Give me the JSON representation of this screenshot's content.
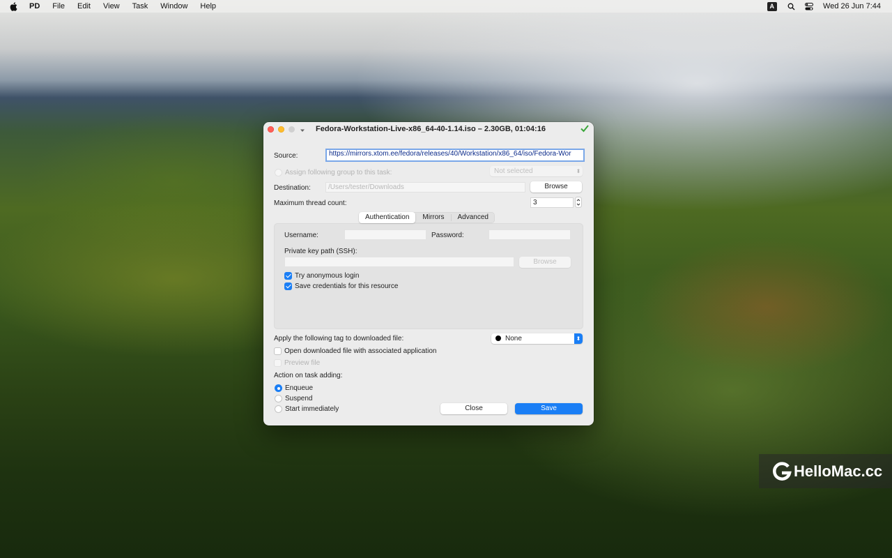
{
  "menubar": {
    "app_name": "PD",
    "menus": [
      "File",
      "Edit",
      "View",
      "Task",
      "Window",
      "Help"
    ],
    "input_badge": "A",
    "datetime": "Wed 26 Jun  7:44"
  },
  "dialog": {
    "title": "Fedora-Workstation-Live-x86_64-40-1.14.iso – 2.30GB, 01:04:16",
    "source_label": "Source:",
    "source_value": "https://mirrors.xtom.ee/fedora/releases/40/Workstation/x86_64/iso/Fedora-Wor",
    "assign_group_label": "Assign following group to this task:",
    "group_select_value": "Not selected",
    "destination_label": "Destination:",
    "destination_value": "/Users/tester/Downloads",
    "browse_label": "Browse",
    "max_thread_label": "Maximum thread count:",
    "max_thread_value": "3",
    "tabs": [
      "Authentication",
      "Mirrors",
      "Advanced"
    ],
    "active_tab": "Authentication",
    "auth": {
      "username_label": "Username:",
      "username_value": "",
      "password_label": "Password:",
      "password_value": "",
      "key_path_label": "Private key path (SSH):",
      "key_path_value": "",
      "browse_label": "Browse",
      "try_anonymous_label": "Try anonymous login",
      "try_anonymous_checked": true,
      "save_credentials_label": "Save credentials for this resource",
      "save_credentials_checked": true
    },
    "tag_label": "Apply the following tag to downloaded file:",
    "tag_value": "None",
    "open_file_label": "Open downloaded file with associated application",
    "open_file_checked": false,
    "preview_label": "Preview file",
    "action_label": "Action on task adding:",
    "actions": [
      "Enqueue",
      "Suspend",
      "Start immediately"
    ],
    "selected_action": "Enqueue",
    "close_label": "Close",
    "save_label": "Save"
  },
  "watermark": "HelloMac.cc",
  "colors": {
    "accent": "#1a7ef5",
    "close": "#ff5f57",
    "minimize": "#febc2e",
    "status_ok": "#3aa63a"
  }
}
